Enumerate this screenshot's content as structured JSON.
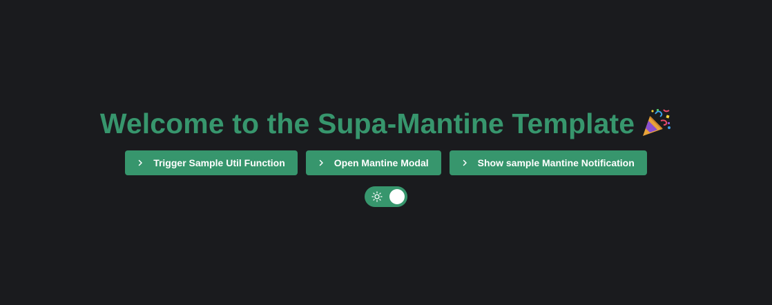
{
  "page": {
    "title": "Welcome to the Supa-Mantine Template",
    "title_emoji": "party-popper-icon"
  },
  "buttons": [
    {
      "label": "Trigger Sample Util Function",
      "icon": "chevron-right-icon"
    },
    {
      "label": "Open Mantine Modal",
      "icon": "chevron-right-icon"
    },
    {
      "label": "Show sample Mantine Notification",
      "icon": "chevron-right-icon"
    }
  ],
  "theme_toggle": {
    "icon": "sun-icon",
    "checked": true
  },
  "colors": {
    "background": "#1a1b1e",
    "accent": "#37966d",
    "text_on_accent": "#ffffff"
  }
}
